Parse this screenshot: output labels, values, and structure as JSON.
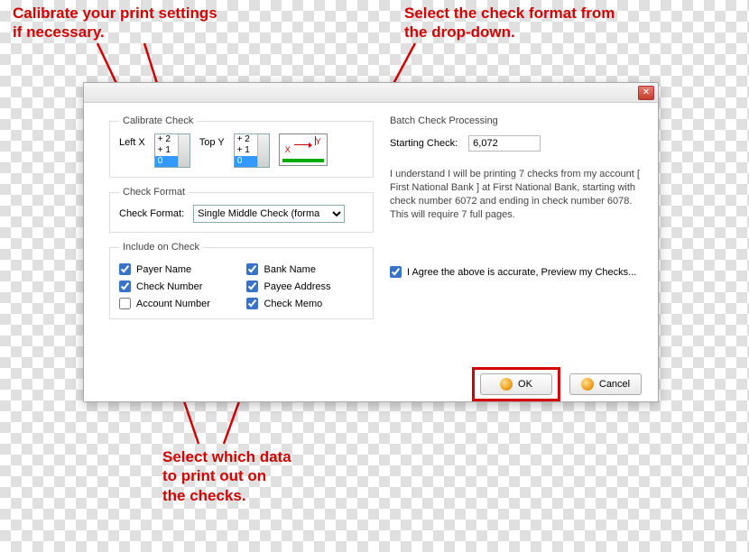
{
  "annotations": {
    "calibrate": "Calibrate your print settings\nif necessary.",
    "format": "Select the check format from\nthe drop-down.",
    "include": "Select which data\nto print out on\nthe checks."
  },
  "dialog": {
    "close": "✕",
    "calibrate": {
      "legend": "Calibrate Check",
      "leftx_label": "Left X",
      "topy_label": "Top Y",
      "spinner_opts": [
        "+ 2",
        "+ 1",
        "0"
      ],
      "preview_x": "X",
      "preview_y": "Y"
    },
    "format": {
      "legend": "Check Format",
      "label": "Check Format:",
      "options": [
        "Single Middle Check (forma"
      ]
    },
    "include": {
      "legend": "Include on Check",
      "items": [
        {
          "label": "Payer Name",
          "checked": true
        },
        {
          "label": "Bank Name",
          "checked": true
        },
        {
          "label": "Check Number",
          "checked": true
        },
        {
          "label": "Payee Address",
          "checked": true
        },
        {
          "label": "Account Number",
          "checked": false
        },
        {
          "label": "Check Memo",
          "checked": true
        }
      ]
    },
    "batch": {
      "heading": "Batch Check Processing",
      "starting_label": "Starting Check:",
      "starting_value": "6,072",
      "confirm_text": "I understand I will be printing 7 checks from my account [ First National Bank ] at First National Bank, starting with check number 6072 and ending in check number 6078. This will require 7 full pages.",
      "agree_label": "I Agree the above is accurate, Preview my Checks...",
      "agree_checked": true
    },
    "buttons": {
      "ok": "OK",
      "cancel": "Cancel"
    }
  }
}
